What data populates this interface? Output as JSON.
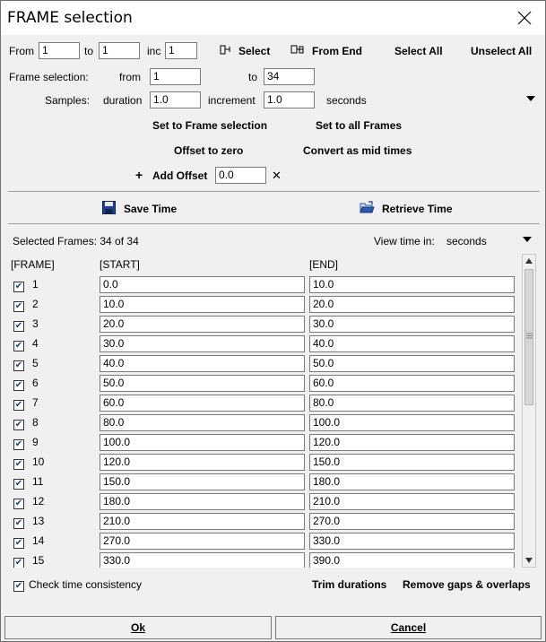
{
  "window": {
    "title": "FRAME selection"
  },
  "range": {
    "from_label": "From",
    "from_value": "1",
    "to_label": "to",
    "to_value": "1",
    "inc_label": "inc",
    "inc_value": "1",
    "select_label": "Select",
    "from_end_label": "From End",
    "select_all_label": "Select All",
    "unselect_all_label": "Unselect All"
  },
  "frame_selection": {
    "label": "Frame selection:",
    "from_label": "from",
    "from_value": "1",
    "to_label": "to",
    "to_value": "34"
  },
  "samples": {
    "label": "Samples:",
    "duration_label": "duration",
    "duration_value": "1.0",
    "increment_label": "increment",
    "increment_value": "1.0",
    "unit": "seconds"
  },
  "actions": {
    "set_to_frame_selection": "Set to Frame selection",
    "set_to_all_frames": "Set to all Frames",
    "offset_to_zero": "Offset to zero",
    "convert_as_mid_times": "Convert as mid times",
    "add_offset_symbol": "+",
    "add_offset_label": "Add Offset",
    "add_offset_value": "0.0",
    "clear_symbol": "✕"
  },
  "time_io": {
    "save_label": "Save Time",
    "retrieve_label": "Retrieve Time"
  },
  "table": {
    "selected_text": "Selected Frames: 34 of 34",
    "view_time_label": "View time in:",
    "view_time_value": "seconds",
    "headers": {
      "frame": "[FRAME]",
      "start": "[START]",
      "end": "[END]"
    },
    "rows": [
      {
        "frame": "1",
        "start": "0.0",
        "end": "10.0"
      },
      {
        "frame": "2",
        "start": "10.0",
        "end": "20.0"
      },
      {
        "frame": "3",
        "start": "20.0",
        "end": "30.0"
      },
      {
        "frame": "4",
        "start": "30.0",
        "end": "40.0"
      },
      {
        "frame": "5",
        "start": "40.0",
        "end": "50.0"
      },
      {
        "frame": "6",
        "start": "50.0",
        "end": "60.0"
      },
      {
        "frame": "7",
        "start": "60.0",
        "end": "80.0"
      },
      {
        "frame": "8",
        "start": "80.0",
        "end": "100.0"
      },
      {
        "frame": "9",
        "start": "100.0",
        "end": "120.0"
      },
      {
        "frame": "10",
        "start": "120.0",
        "end": "150.0"
      },
      {
        "frame": "11",
        "start": "150.0",
        "end": "180.0"
      },
      {
        "frame": "12",
        "start": "180.0",
        "end": "210.0"
      },
      {
        "frame": "13",
        "start": "210.0",
        "end": "270.0"
      },
      {
        "frame": "14",
        "start": "270.0",
        "end": "330.0"
      },
      {
        "frame": "15",
        "start": "330.0",
        "end": "390.0"
      }
    ]
  },
  "footer": {
    "check_consistency_label": "Check time consistency",
    "trim_durations_label": "Trim durations",
    "remove_gaps_label": "Remove gaps & overlaps",
    "ok_label": "Ok",
    "cancel_label": "Cancel"
  },
  "colors": {
    "check_mark": "#1a3f8a",
    "save_icon": "#1f3f8f",
    "folder_icon": "#2a5aa8"
  }
}
